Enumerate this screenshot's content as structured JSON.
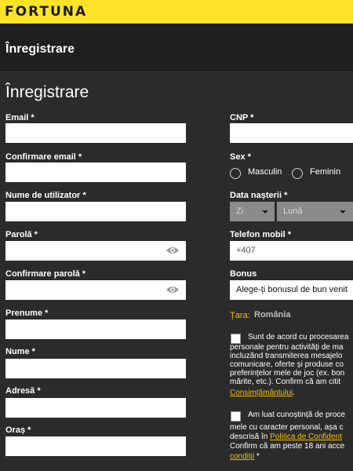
{
  "brand": {
    "logo_text": "FORTUNA"
  },
  "header": {
    "title": "Înregistrare"
  },
  "form": {
    "title": "Înregistrare",
    "left": {
      "email_label": "Email *",
      "confirm_email_label": "Confirmare email *",
      "username_label": "Nume de utilizator *",
      "password_label": "Parolă *",
      "confirm_password_label": "Confirmare parolă *",
      "first_name_label": "Prenume *",
      "last_name_label": "Nume *",
      "address_label": "Adresă *",
      "city_label": "Oraș *"
    },
    "right": {
      "cnp_label": "CNP *",
      "sex_label": "Sex *",
      "sex_options": [
        "Masculin",
        "Feminin"
      ],
      "birthdate_label": "Data nașterii *",
      "day_placeholder": "Zi",
      "month_placeholder": "Lună",
      "phone_label": "Telefon mobil *",
      "phone_prefix": "+407",
      "bonus_label": "Bonus",
      "bonus_value": "Alege-ți bonusul de bun venit",
      "country_label": "Țara:",
      "country_value": "România"
    },
    "consent1": {
      "line1": "Sunt de acord cu procesarea",
      "line2": "personale pentru activități de ma",
      "line3": "incluzând transmiterea mesajelo",
      "line4": "comunicare, oferte și produse co",
      "line5": "preferințelor mele de joc (ex. bon",
      "line6": "mărite, etc.). Confirm că am citit",
      "link": "Consimțământului",
      "end": "."
    },
    "consent2": {
      "line1": "Am luat cunoștință de proce",
      "line2": "mele cu caracter personal, așa c",
      "line3_pre": "descrisă în ",
      "line3_link": "Politica de Confident",
      "line4": "Confirm că am peste 18 ani acce",
      "line5_link": "condiții",
      "line5_post": " *"
    }
  },
  "colors": {
    "brand_yellow": "#fde428",
    "link_yellow": "#f3c000",
    "background": "#2b2b2b",
    "header": "#1f1f1f"
  },
  "icons": {
    "password_toggle": "eye-icon",
    "dropdown": "chevron-down-icon"
  }
}
